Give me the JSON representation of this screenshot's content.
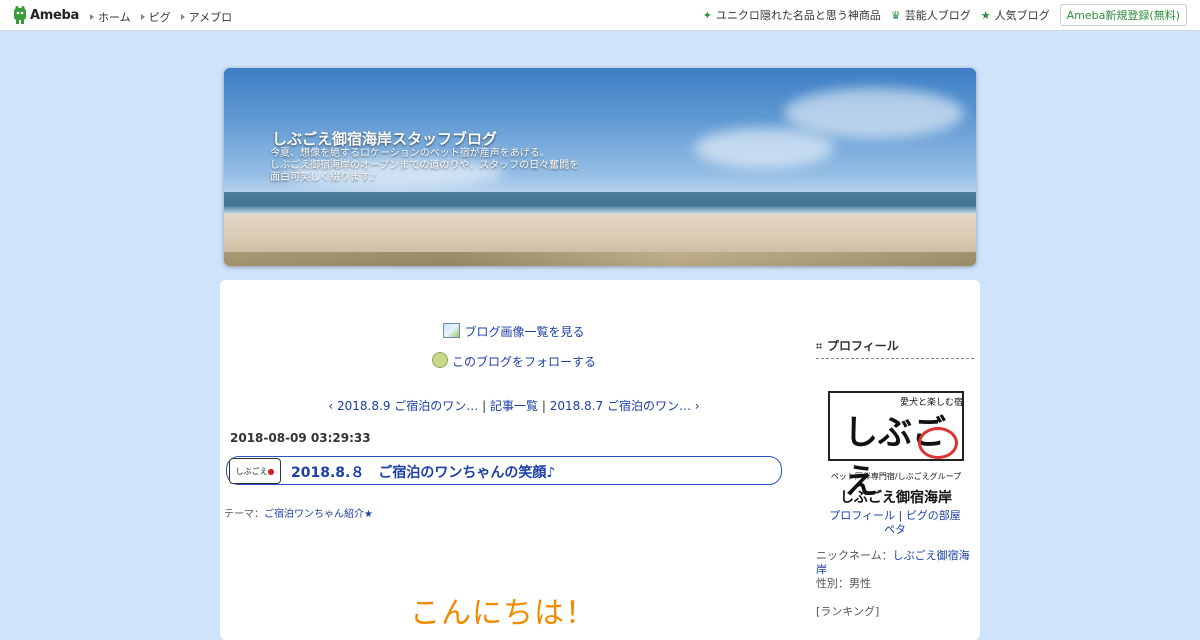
{
  "topbar": {
    "logo_text": "Ameba",
    "nav_left": [
      "ホーム",
      "ピグ",
      "アメブロ"
    ],
    "nav_right": [
      {
        "icon": "sparkle-icon",
        "label": "ユニクロ隠れた名品と思う神商品"
      },
      {
        "icon": "crown-icon",
        "label": "芸能人ブログ"
      },
      {
        "icon": "star-icon",
        "label": "人気ブログ"
      }
    ],
    "register_label": "Ameba新規登録(無料)"
  },
  "blog": {
    "title": "しぶごえ御宿海岸スタッフブログ",
    "description_lines": [
      "今夏、想像を絶するロケーションのペット宿が産声をあげる。",
      "しぶごえ御宿海岸のオープンまでの道のりや、スタッフの日々奮闘を",
      "面白可笑しく綴ります♪"
    ]
  },
  "links": {
    "image_list": "ブログ画像一覧を見る",
    "follow": "このブログをフォローする"
  },
  "pager": {
    "prev": "2018.8.9 ご宿泊のワン…",
    "list": "記事一覧",
    "next": "2018.8.7 ご宿泊のワン…",
    "sep": "|"
  },
  "entry": {
    "date": "2018-08-09 03:29:33",
    "title": "2018.8.８　ご宿泊のワンちゃんの笑顔♪",
    "theme_label": "テーマ：",
    "theme": "ご宿泊ワンちゃん紹介★",
    "greeting": "こんにちは！"
  },
  "sidebar": {
    "heading": "プロフィール",
    "image_text": {
      "top": "愛犬と楽しむ宿",
      "big": "しぶごえ",
      "line1": "ペット同伴専門宿/しぶごえグループ",
      "line2": "しぶごえ御宿海岸"
    },
    "links": [
      "プロフィール",
      "ピグの部屋",
      "ペタ"
    ],
    "nickname_label": "ニックネーム：",
    "nickname": "しぶごえ御宿海岸",
    "gender": "性別：男性",
    "ranking": "[ランキング]"
  }
}
